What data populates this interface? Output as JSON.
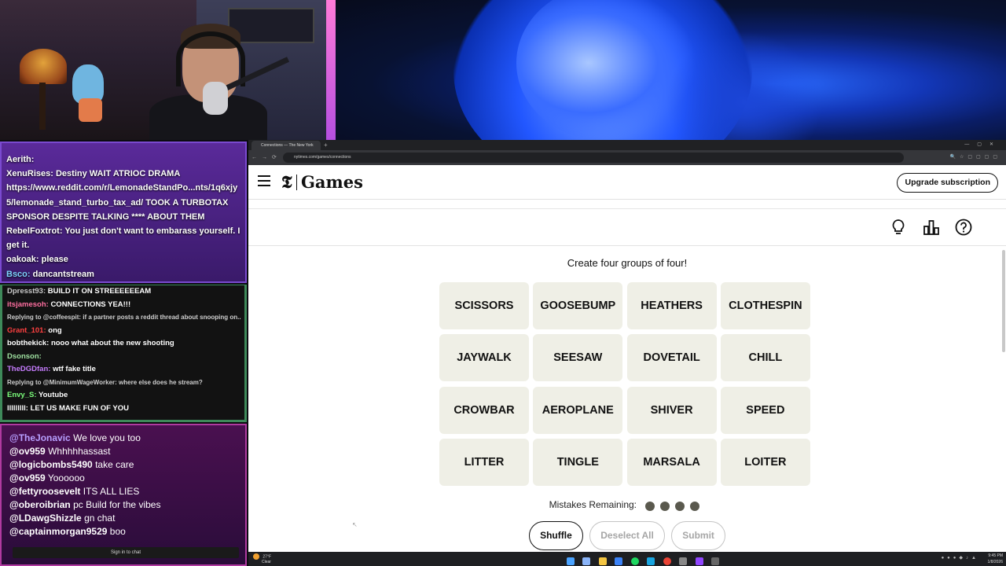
{
  "chat_top": [
    {
      "user": "Aerith:",
      "text": "",
      "user_color": "#ffffff"
    },
    {
      "user": "XenuRises:",
      "text": "Destiny WAIT ATRIOC DRAMA",
      "user_color": "#ffffff"
    },
    {
      "user": "",
      "text": "https://www.reddit.com/r/LemonadeStandPo...nts/1q6xjy",
      "user_color": "#ffffff"
    },
    {
      "user": "",
      "text": "5/lemonade_stand_turbo_tax_ad/ TOOK A TURBOTAX",
      "user_color": "#ffffff"
    },
    {
      "user": "",
      "text": "SPONSOR DESPITE TALKING **** ABOUT THEM",
      "user_color": "#ffffff"
    },
    {
      "user": "RebelFoxtrot:",
      "text": "You just don't want to embarass yourself. I",
      "user_color": "#ffffff"
    },
    {
      "user": "",
      "text": "get it.",
      "user_color": "#ffffff"
    },
    {
      "user": "oakoak:",
      "text": "please",
      "user_color": "#ffffff"
    },
    {
      "user": "Bsco:",
      "text": "dancantstream",
      "user_color": "#7fd3ff"
    }
  ],
  "chat_mid": [
    {
      "user": "Dpresst93:",
      "text": "BUILD IT ON STREEEEEEAM",
      "user_color": "#c8c8c8",
      "reply": false
    },
    {
      "user": "itsjamesoh:",
      "text": "CONNECTIONS YEA!!!",
      "user_color": "#ff6fa0",
      "reply": false
    },
    {
      "user": "",
      "text": "Replying to @coffeespit: if a partner posts a reddit thread about snooping on...",
      "user_color": "#cfcfcf",
      "reply": true
    },
    {
      "user": "Grant_101:",
      "text": "ong",
      "user_color": "#ff4040",
      "reply": false
    },
    {
      "user": "bobthekick:",
      "text": "nooo what about the new shooting",
      "user_color": "#ffffff",
      "reply": false
    },
    {
      "user": "Dsonson:",
      "text": "",
      "user_color": "#9fe0a0",
      "reply": false
    },
    {
      "user": "TheDGDfan:",
      "text": "wtf fake title",
      "user_color": "#c77dff",
      "reply": false
    },
    {
      "user": "",
      "text": "Replying to @MinimumWageWorker: where else does he stream?",
      "user_color": "#cfcfcf",
      "reply": true
    },
    {
      "user": "Envy_S:",
      "text": "Youtube",
      "user_color": "#7cff7c",
      "reply": false
    },
    {
      "user": "lllllllll:",
      "text": "LET US MAKE FUN OF YOU",
      "user_color": "#ffffff",
      "reply": false
    }
  ],
  "chat_bottom": [
    {
      "user": "@TheJonavic",
      "text": "We love you too",
      "user_color": "#b8a0ff"
    },
    {
      "user": "@ov959",
      "text": "Whhhhhassast",
      "user_color": "#ffffff"
    },
    {
      "user": "@logicbombs5490",
      "text": "take care",
      "user_color": "#ffffff"
    },
    {
      "user": "@ov959",
      "text": "Yoooooo",
      "user_color": "#ffffff"
    },
    {
      "user": "@fettyroosevelt",
      "text": "ITS ALL LIES",
      "user_color": "#ffffff"
    },
    {
      "user": "@oberoibrian",
      "text": "pc Build for the vibes",
      "user_color": "#ffffff"
    },
    {
      "user": "@LDawgShizzle",
      "text": "gn chat",
      "user_color": "#ffffff"
    },
    {
      "user": "@captainmorgan9529",
      "text": "boo",
      "user_color": "#ffffff"
    }
  ],
  "chat_signin": "Sign in to chat",
  "browser": {
    "tab_title": "Connections — The New York",
    "url": "nytimes.com/games/connections"
  },
  "nyt": {
    "logo_t": "𝕿",
    "games_word": "Games",
    "upgrade_label": "Upgrade subscription"
  },
  "game": {
    "prompt": "Create four groups of four!",
    "tiles": [
      "SCISSORS",
      "GOOSEBUMP",
      "HEATHERS",
      "CLOTHESPIN",
      "JAYWALK",
      "SEESAW",
      "DOVETAIL",
      "CHILL",
      "CROWBAR",
      "AEROPLANE",
      "SHIVER",
      "SPEED",
      "LITTER",
      "TINGLE",
      "MARSALA",
      "LOITER"
    ],
    "mistakes_label": "Mistakes Remaining:",
    "mistakes_remaining": 4,
    "shuffle_label": "Shuffle",
    "deselect_label": "Deselect All",
    "submit_label": "Submit"
  },
  "taskbar": {
    "weather_temp": "27°F",
    "weather_desc": "Clear",
    "time": "9:45 PM",
    "date": "1/8/2026"
  },
  "colors": {
    "tile_bg": "#efefe6",
    "dot": "#5a594e"
  }
}
